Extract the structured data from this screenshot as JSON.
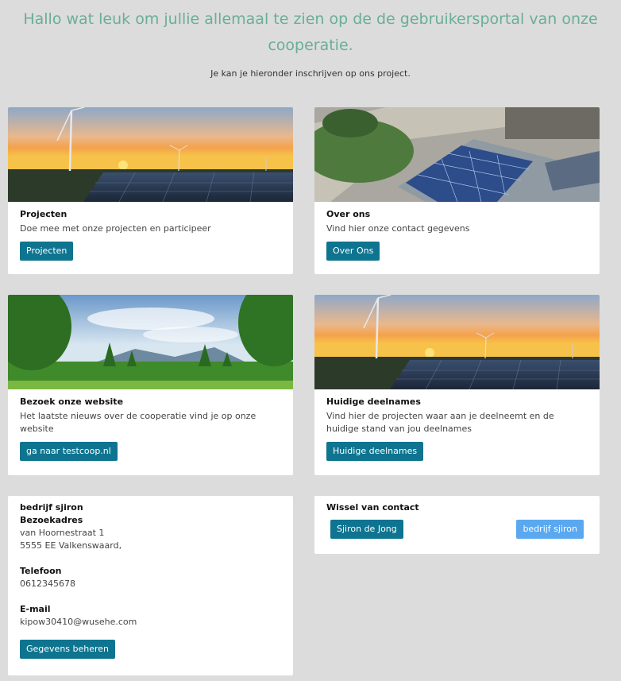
{
  "header": {
    "title": "Hallo wat leuk om jullie allemaal te zien op de de gebruikersportal van onze cooperatie.",
    "subtitle": "Je kan je hieronder inschrijven op ons project."
  },
  "cards": [
    {
      "title": "Projecten",
      "text": "Doe mee met onze projecten en participeer",
      "button": "Projecten",
      "image": "solar-windmill-sunset"
    },
    {
      "title": "Over ons",
      "text": "Vind hier onze contact gegevens",
      "button": "Over Ons",
      "image": "solar-roof-aerial"
    },
    {
      "title": "Bezoek onze website",
      "text": "Het laatste nieuws over de cooperatie vind je op onze website",
      "button": "ga naar testcoop.nl",
      "image": "forest-landscape"
    },
    {
      "title": "Huidige deelnames",
      "text": "Vind hier de projecten waar aan je deelneemt en de huidige stand van jou deelnames",
      "button": "Huidige deelnames",
      "image": "solar-windmill-sunset"
    }
  ],
  "company": {
    "name": "bedrijf sjiron",
    "address_label": "Bezoekadres",
    "street": "van Hoornestraat 1",
    "city": "5555 EE Valkenswaard,",
    "phone_label": "Telefoon",
    "phone": "0612345678",
    "email_label": "E-mail",
    "email": "kipow30410@wusehe.com",
    "manage_button": "Gegevens beheren"
  },
  "switch_contact": {
    "title": "Wissel van contact",
    "person_button": "Sjiron de Jong",
    "company_button": "bedrijf sjiron"
  },
  "colors": {
    "accent": "#6aae98",
    "button": "#0e7490",
    "button_light": "#5aa8f0",
    "background": "#dcdcdc"
  }
}
